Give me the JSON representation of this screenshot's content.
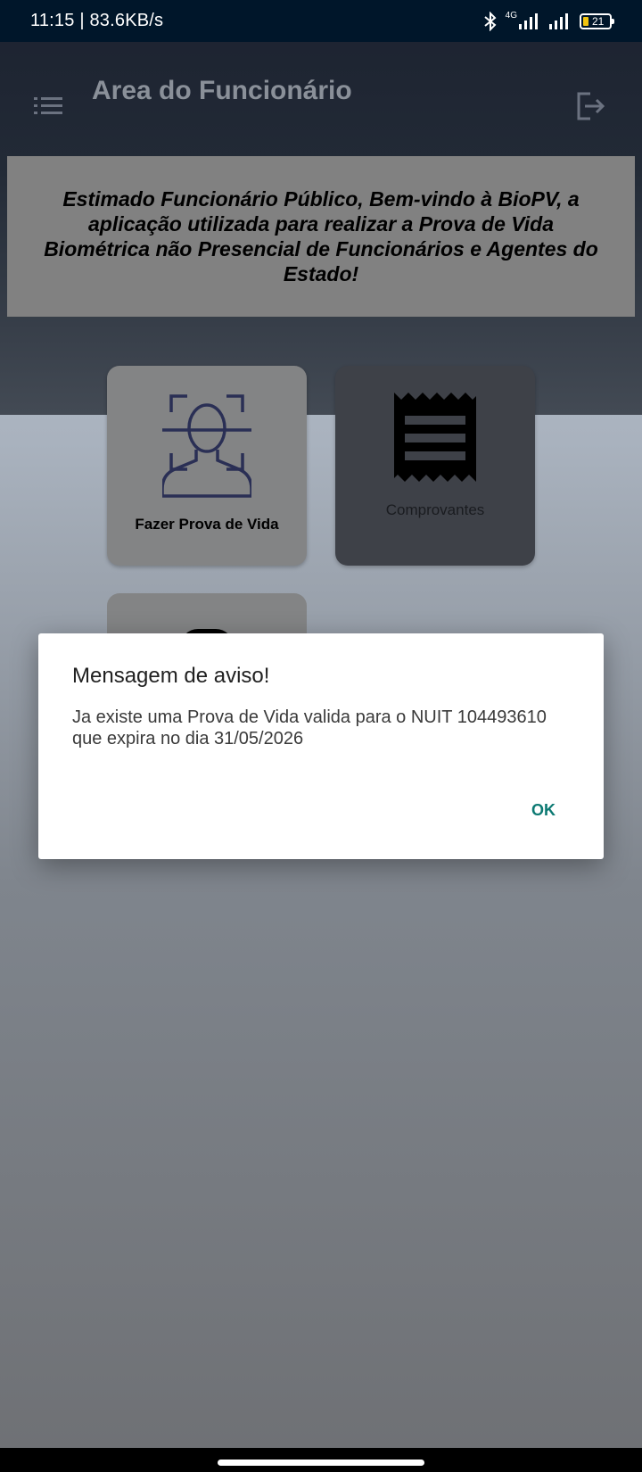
{
  "status_bar": {
    "time_speed": "11:15 | 83.6KB/s",
    "network": "4G",
    "battery": "21",
    "icons": [
      "bluetooth-icon",
      "signal-icon",
      "signal-icon",
      "battery-icon"
    ]
  },
  "app_bar": {
    "title": "Area do Funcionário",
    "menu_icon": "list-icon",
    "logout_icon": "logout-icon"
  },
  "welcome": {
    "text": "Estimado Funcionário Público, Bem-vindo à BioPV, a aplicação utilizada para realizar a Prova de Vida Biométrica não Presencial de Funcionários e Agentes do Estado!"
  },
  "tiles": [
    {
      "label": "Fazer Prova de Vida",
      "icon": "face-scan-icon"
    },
    {
      "label": "Comprovantes",
      "icon": "receipt-icon"
    }
  ],
  "dialog": {
    "title": "Mensagem de aviso!",
    "message": "Ja existe uma Prova de Vida valida para o NUIT 104493610 que expira no dia 31/05/2026",
    "ok_label": "OK"
  },
  "colors": {
    "status_bar": "#00162a",
    "accent": "#0d7a73",
    "dialog_bg": "#ffffff"
  }
}
